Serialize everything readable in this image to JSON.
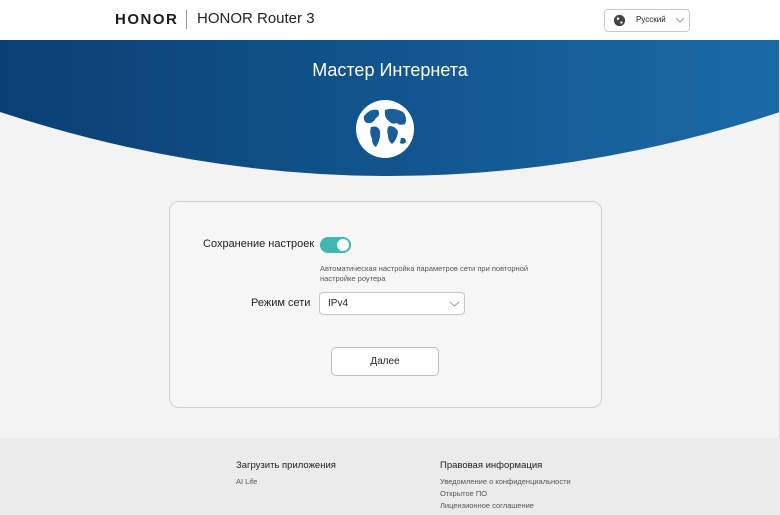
{
  "header": {
    "brand": "HONOR",
    "product": "HONOR Router 3",
    "language": {
      "selected": "Русский",
      "icon": "globe-icon"
    }
  },
  "hero": {
    "title": "Мастер Интернета",
    "icon": "world-globe-icon",
    "gradient": [
      "#0a3f73",
      "#1a6aa8"
    ]
  },
  "form": {
    "save_settings": {
      "label": "Сохранение настроек",
      "enabled": true,
      "hint_line1": "Автоматическая настройка параметров сети при повторной",
      "hint_line2": "настройке роутера"
    },
    "network_mode": {
      "label": "Режим сети",
      "selected": "IPv4"
    },
    "next_label": "Далее"
  },
  "footer": {
    "apps": {
      "heading": "Загрузить приложения",
      "links": [
        "AI Life"
      ]
    },
    "legal": {
      "heading": "Правовая информация",
      "links": [
        "Уведомление о конфиденциальности",
        "Открытое ПО",
        "Лицензионное соглашение"
      ]
    }
  },
  "colors": {
    "accent": "#3fb7b2",
    "hero": "#0f5a96",
    "background": "#f3f3f3"
  }
}
